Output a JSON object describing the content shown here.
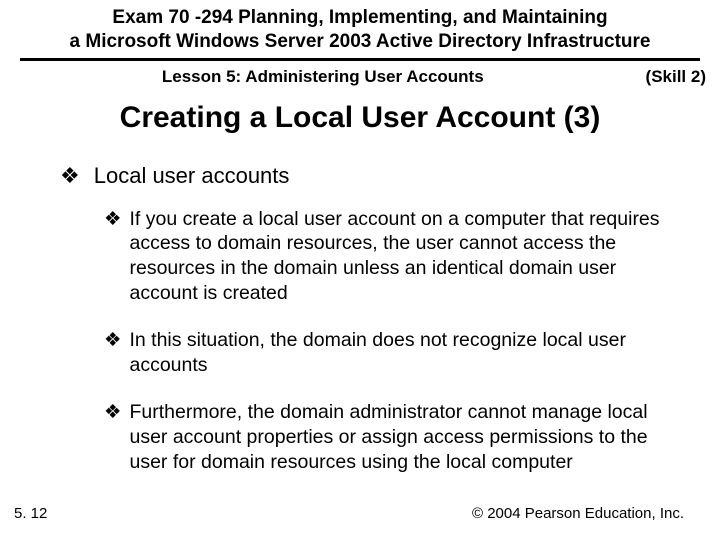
{
  "header": {
    "exam_line1": "Exam 70 -294 Planning, Implementing, and Maintaining",
    "exam_line2": "a Microsoft Windows Server 2003 Active Directory Infrastructure",
    "lesson": "Lesson 5: Administering User Accounts",
    "skill": "(Skill 2)"
  },
  "title": "Creating a Local User Account (3)",
  "bullets": {
    "b1": "Local user accounts",
    "b1_1": "If you create a local user account on a computer that requires access to domain resources, the user cannot access the resources in the domain unless an identical domain user account is created",
    "b1_2": "In this situation, the domain does not recognize local user accounts",
    "b1_3": "Furthermore, the domain administrator cannot manage local user account properties or assign access permissions to the user for domain resources using the local computer"
  },
  "footer": {
    "page": "5. 12",
    "copyright": "© 2004 Pearson Education, Inc."
  },
  "glyph": "❖"
}
